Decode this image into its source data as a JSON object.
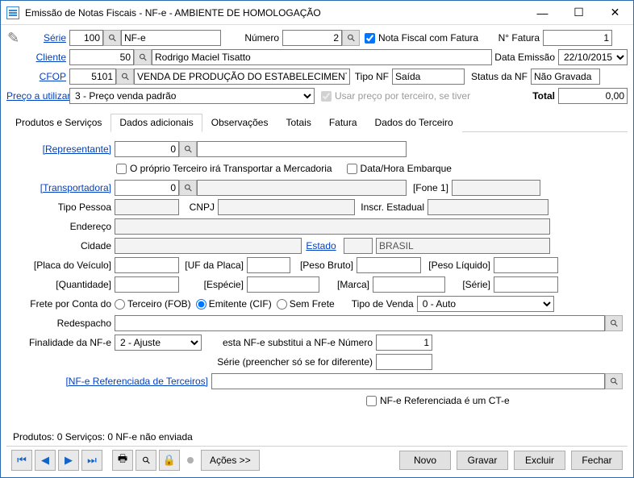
{
  "titlebar": {
    "text": "Emissão de Notas Fiscais - NF-e - AMBIENTE DE HOMOLOGAÇÃO"
  },
  "header": {
    "serie_label": "Série",
    "serie": "100",
    "serie_desc": "NF-e",
    "numero_label": "Número",
    "numero": "2",
    "nf_fatura_label": "Nota Fiscal com Fatura",
    "nf_fatura": true,
    "nfatura_label": "N° Fatura",
    "nfatura": "1",
    "cliente_label": "Cliente",
    "cliente": "50",
    "cliente_nome": "Rodrigo Maciel Tisatto",
    "data_emissao_label": "Data Emissão",
    "data_emissao": "22/10/2015",
    "cfop_label": "CFOP",
    "cfop": "5101",
    "cfop_desc": "VENDA DE PRODUÇÃO DO ESTABELECIMENTO",
    "tiponf_label": "Tipo NF",
    "tiponf": "Saída",
    "status_label": "Status da NF",
    "status": "Não Gravada",
    "preco_label": "Preço a utilizar",
    "preco_sel": "3 - Preço venda padrão",
    "usar_preco_terc_label": "Usar preço por terceiro, se tiver",
    "total_label": "Total",
    "total": "0,00"
  },
  "tabs": [
    "Produtos e Serviços",
    "Dados adicionais",
    "Observações",
    "Totais",
    "Fatura",
    "Dados do Terceiro"
  ],
  "active_tab": 1,
  "page": {
    "representante_label": "[Representante]",
    "representante": "0",
    "proprio_terc_label": "O próprio Terceiro irá Transportar a Mercadoria",
    "proprio_terc": false,
    "data_emb_label": "Data/Hora Embarque",
    "data_emb": false,
    "transportadora_label": "[Transportadora]",
    "transportadora": "0",
    "fone1_label": "[Fone 1]",
    "fone1": "",
    "tipo_pessoa_label": "Tipo Pessoa",
    "tipo_pessoa": "",
    "cnpj_label": "CNPJ",
    "cnpj": "",
    "ie_label": "Inscr. Estadual",
    "ie": "",
    "endereco_label": "Endereço",
    "endereco": "",
    "cidade_label": "Cidade",
    "cidade": "",
    "estado_link": "Estado",
    "estado": "",
    "pais": "BRASIL",
    "placa_label": "[Placa do Veículo]",
    "placa": "",
    "ufplaca_label": "[UF da Placa]",
    "ufplaca": "",
    "pesobruto_label": "[Peso Bruto]",
    "pesobruto": "",
    "pesoliq_label": "[Peso Líquido]",
    "pesoliq": "",
    "quantidade_label": "[Quantidade]",
    "quantidade": "",
    "especie_label": "[Espécie]",
    "especie": "",
    "marca_label": "[Marca]",
    "marca": "",
    "serie2_label": "[Série]",
    "serie2": "",
    "frete_label": "Frete por Conta do",
    "frete_opts": [
      "Terceiro (FOB)",
      "Emitente (CIF)",
      "Sem Frete"
    ],
    "frete_sel": 1,
    "tipovenda_label": "Tipo de Venda",
    "tipovenda": "0 - Auto",
    "redespacho_label": "Redespacho",
    "redespacho": "",
    "finalidade_label": "Finalidade da NF-e",
    "finalidade": "2 - Ajuste",
    "substitui_label": "esta NF-e substitui a NF-e Número",
    "substitui": "1",
    "serie3_label": "Série (preencher só se for diferente)",
    "serie3": "",
    "nfe_ref_label": "[NF-e Referenciada de Terceiros]",
    "nfe_ref": "",
    "nfe_cte_label": "NF-e Referenciada é um CT-e",
    "nfe_cte": false
  },
  "status": {
    "text": "Produtos: 0    Serviços: 0   NF-e não enviada"
  },
  "toolbar": {
    "acoes": "Ações >>",
    "buttons": [
      "Novo",
      "Gravar",
      "Excluir",
      "Fechar"
    ]
  }
}
